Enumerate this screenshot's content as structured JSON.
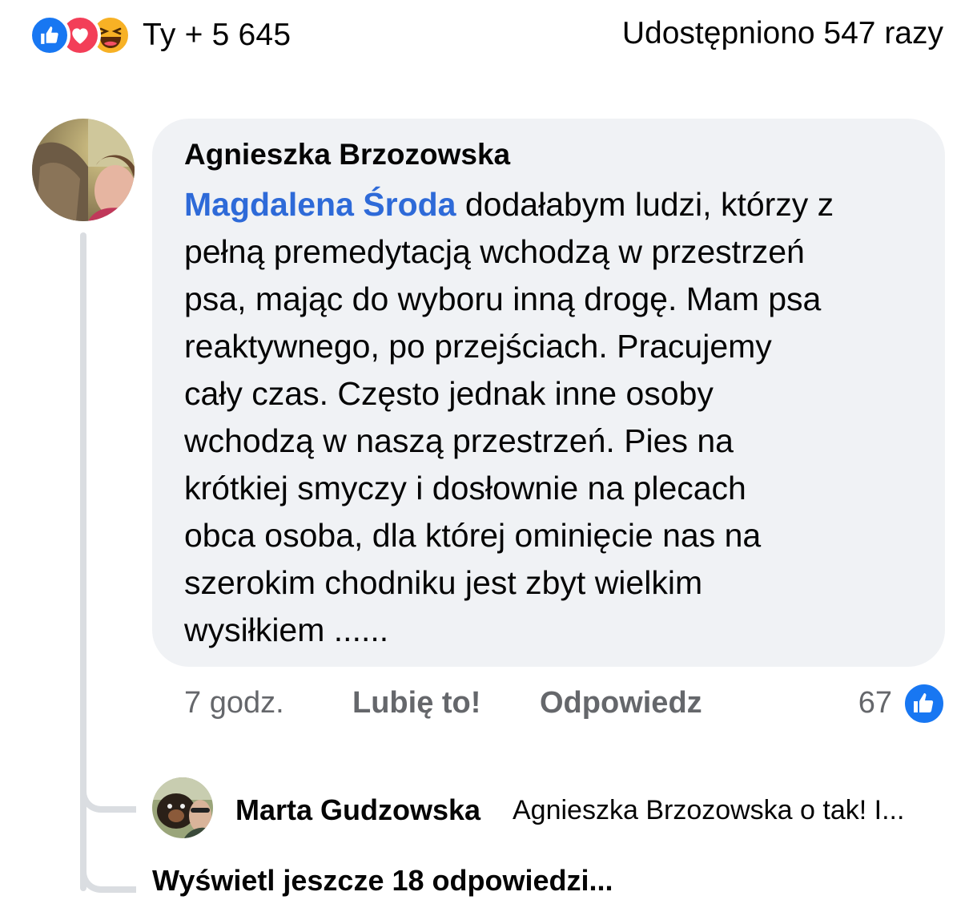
{
  "reactions": {
    "icons": [
      "like-icon",
      "love-icon",
      "haha-icon"
    ],
    "summary": "Ty + 5 645",
    "shares": "Udostępniono 547 razy"
  },
  "comment": {
    "author": "Agnieszka Brzozowska",
    "mention": "Magdalena Środa",
    "text_lines": [
      " dodałabym ludzi, którzy z",
      "pełną premedytacją wchodzą w przestrzeń",
      "psa, mając do wyboru inną drogę. Mam psa",
      "reaktywnego, po przejściach. Pracujemy",
      "cały czas. Często jednak inne osoby",
      "wchodzą w naszą przestrzeń. Pies na",
      "krótkiej smyczy i dosłownie na plecach",
      "obca osoba, dla której ominięcie nas na",
      "szerokim chodniku jest zbyt wielkim",
      "wysiłkiem ......"
    ],
    "time": "7 godz.",
    "like_label": "Lubię to!",
    "reply_label": "Odpowiedz",
    "like_count": "67"
  },
  "reply": {
    "author": "Marta Gudzowska",
    "text": "Agnieszka Brzozowska o tak! I..."
  },
  "more_replies": "Wyświetl jeszcze 18 odpowiedzi...",
  "colors": {
    "like_blue": "#1877f2",
    "love_red": "#f33e58",
    "haha_yellow": "#f7b125",
    "mention_blue": "#2e6ad8",
    "bubble_bg": "#f0f2f5",
    "meta_gray": "#65676b"
  }
}
